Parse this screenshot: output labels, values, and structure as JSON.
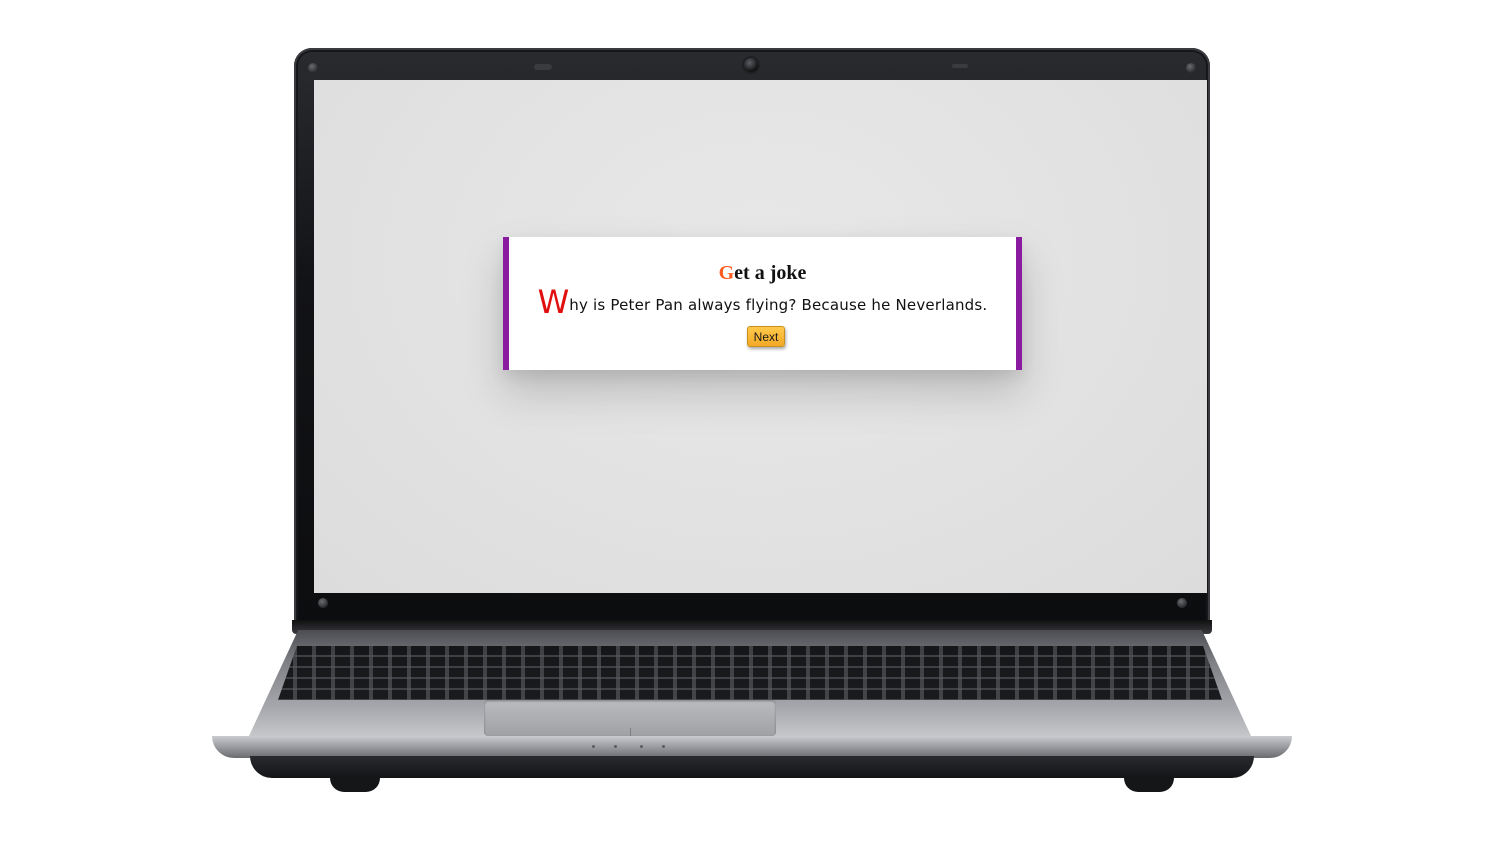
{
  "joke_app": {
    "title_first_letter": "G",
    "title_rest": "et a joke",
    "joke_first_letter": "W",
    "joke_rest": "hy is Peter Pan always flying? Because he Neverlands.",
    "next_label": "Next"
  },
  "colors": {
    "title_accent": "#ff5a1f",
    "joke_drop_cap": "#e01010",
    "card_border": "#8a1aa0",
    "button_fill": "#f3a927"
  },
  "device": {
    "type": "laptop"
  }
}
